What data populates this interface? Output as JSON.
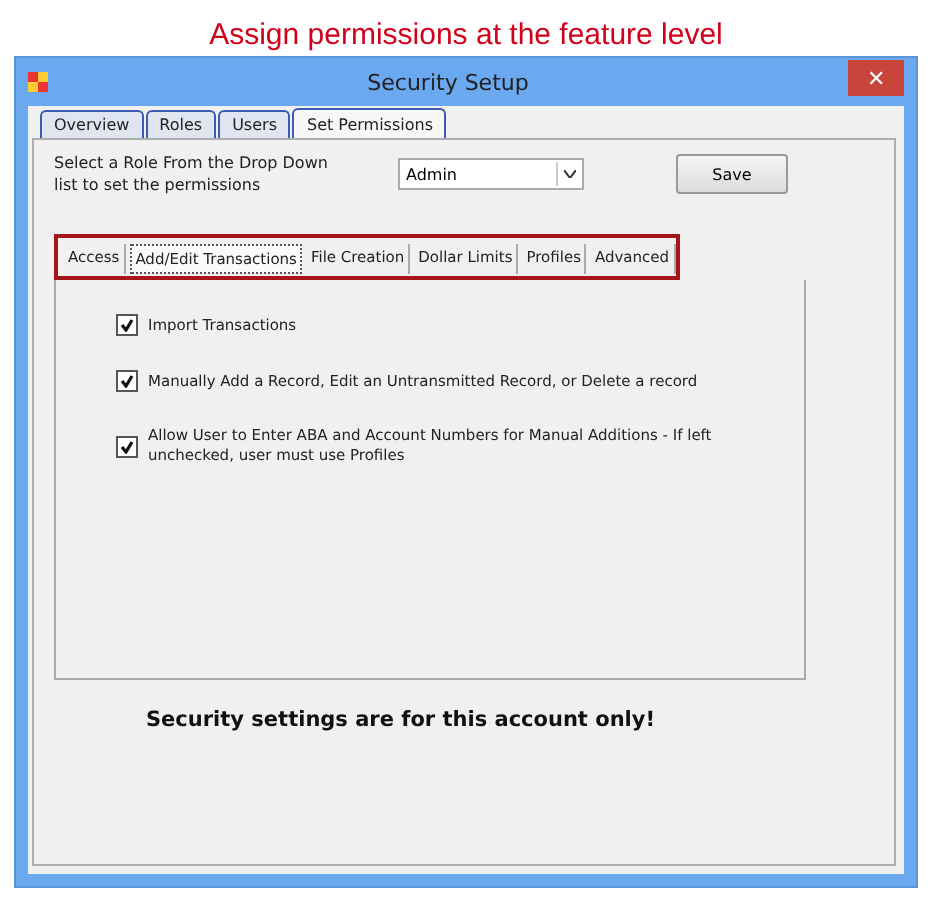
{
  "caption": "Assign permissions at the feature level",
  "window": {
    "title": "Security Setup",
    "close": "✕"
  },
  "tabs": [
    {
      "label": "Overview",
      "selected": false
    },
    {
      "label": "Roles",
      "selected": false
    },
    {
      "label": "Users",
      "selected": false
    },
    {
      "label": "Set Permissions",
      "selected": true
    }
  ],
  "role_prompt": "Select a Role From the Drop Down list to set the permissions",
  "role_select": {
    "value": "Admin"
  },
  "save_button": "Save",
  "sub_tabs": [
    {
      "label": "Access",
      "selected": false
    },
    {
      "label": "Add/Edit Transactions",
      "selected": true
    },
    {
      "label": "File Creation",
      "selected": false
    },
    {
      "label": "Dollar Limits",
      "selected": false
    },
    {
      "label": "Profiles",
      "selected": false
    },
    {
      "label": "Advanced",
      "selected": false
    }
  ],
  "permissions": [
    {
      "label": "Import Transactions",
      "checked": true
    },
    {
      "label": "Manually Add a Record, Edit an Untransmitted Record, or Delete a record",
      "checked": true
    },
    {
      "label": "Allow User to Enter ABA and Account Numbers for Manual Additions - If left unchecked, user must use Profiles",
      "checked": true
    }
  ],
  "notice": "Security settings are for this account only!"
}
